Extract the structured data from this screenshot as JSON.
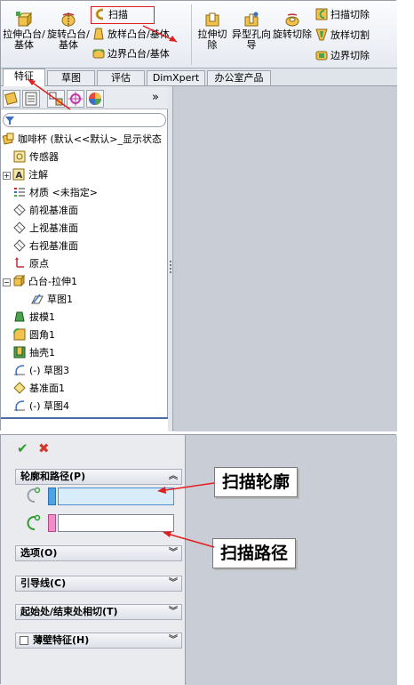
{
  "ribbon": {
    "extrude_boss": "拉伸凸台/基体",
    "revolve_boss": "旋转凸台/基体",
    "sweep": "扫描",
    "loft_boss": "放样凸台/基体",
    "boundary_boss": "边界凸台/基体",
    "extrude_cut": "拉伸切除",
    "hole_wizard": "异型孔向导",
    "revolve_cut": "旋转切除",
    "sweep_cut": "扫描切除",
    "loft_cut": "放样切割",
    "boundary_cut": "边界切除"
  },
  "tabs": [
    "特征",
    "草图",
    "评估",
    "DimXpert",
    "办公室产品"
  ],
  "feature_tree": {
    "root": "咖啡杯  (默认<<默认>_显示状态",
    "items": [
      {
        "label": "传感器"
      },
      {
        "label": "注解"
      },
      {
        "label": "材质 <未指定>"
      },
      {
        "label": "前视基准面"
      },
      {
        "label": "上视基准面"
      },
      {
        "label": "右视基准面"
      },
      {
        "label": "原点"
      },
      {
        "label": "凸台-拉伸1"
      },
      {
        "label": "草图1"
      },
      {
        "label": "拔模1"
      },
      {
        "label": "圆角1"
      },
      {
        "label": "抽壳1"
      },
      {
        "label": "(-) 草图3"
      },
      {
        "label": "基准面1"
      },
      {
        "label": "(-) 草图4"
      }
    ],
    "more_tabs": "»"
  },
  "property_manager": {
    "ok": "✔",
    "cancel": "✖",
    "groups": {
      "profile_path": "轮廓和路径(P)",
      "options": "选项(O)",
      "guide_curves": "引导线(C)",
      "tangency": "起始处/结束处相切(T)",
      "thin_feature": "薄壁特征(H)"
    }
  },
  "callouts": {
    "profile": "扫描轮廓",
    "path": "扫描路径"
  },
  "colors": {
    "highlight_red": "#e02020",
    "profile_field": "#d8ecfa",
    "profile_swatch": "#4da3e6",
    "path_swatch": "#f08cc8",
    "ok_green": "#2f9a2f",
    "cancel_red": "#d43a2a"
  }
}
